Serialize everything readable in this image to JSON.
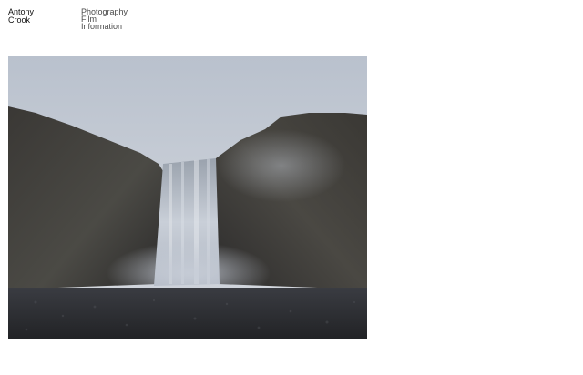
{
  "site": {
    "name_line1": "Antony",
    "name_line2": "Crook"
  },
  "nav": {
    "items": [
      {
        "label": "Photography"
      },
      {
        "label": "Film"
      },
      {
        "label": "Information"
      }
    ]
  },
  "hero": {
    "subject": "waterfall-photograph",
    "colors": {
      "sky_top": "#b9c1cd",
      "sky_bottom": "#d9dce1",
      "cliff_dark": "#2b2a2a",
      "cliff_mid": "#4b4a45",
      "mist": "#bfc6d2",
      "ground": "#2a2b2e"
    }
  }
}
